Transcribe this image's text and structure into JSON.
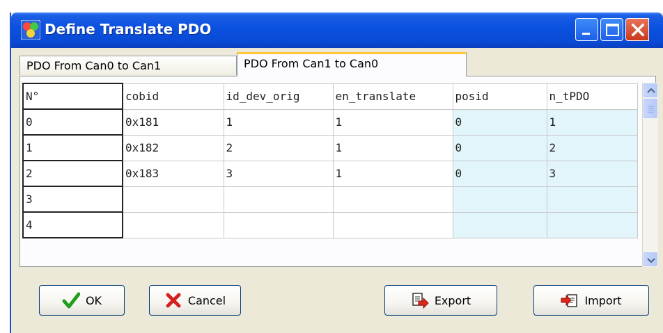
{
  "window": {
    "title": "Define Translate PDO",
    "controls": {
      "minimize": "minimize",
      "maximize": "maximize",
      "close": "close"
    },
    "accent_color": "#0a52e0"
  },
  "tabs": [
    {
      "label": "PDO From Can0 to Can1",
      "active": false
    },
    {
      "label": "PDO From Can1 to Can0",
      "active": true
    }
  ],
  "table": {
    "columns": [
      "N°",
      "cobid",
      "id_dev_orig",
      "en_translate",
      "posid",
      "n_tPDO"
    ],
    "rows": [
      [
        "0",
        "0x181",
        "1",
        "1",
        "0",
        "1"
      ],
      [
        "1",
        "0x182",
        "2",
        "1",
        "0",
        "2"
      ],
      [
        "2",
        "0x183",
        "3",
        "1",
        "0",
        "3"
      ],
      [
        "3",
        "",
        "",
        "",
        "",
        ""
      ],
      [
        "4",
        "",
        "",
        "",
        "",
        ""
      ]
    ],
    "highlight_color": "#e1f5fb"
  },
  "buttons": {
    "ok": "OK",
    "cancel": "Cancel",
    "export": "Export",
    "import": "Import"
  },
  "icons": {
    "app": "app-icon",
    "ok": "checkmark-icon",
    "cancel": "x-icon",
    "export": "export-icon",
    "import": "import-icon"
  }
}
